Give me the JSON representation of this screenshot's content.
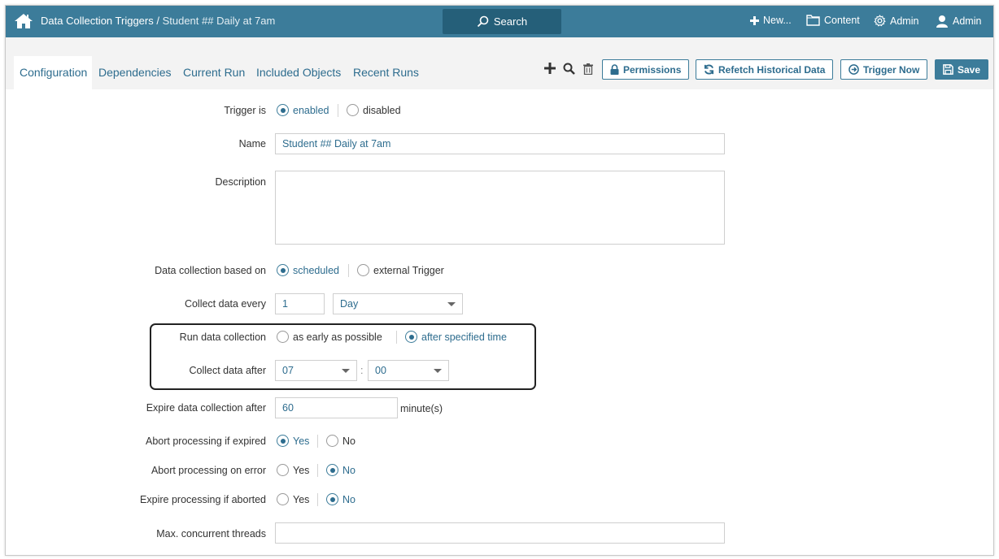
{
  "header": {
    "breadcrumb_root": "Data Collection Triggers",
    "breadcrumb_sep": " / ",
    "breadcrumb_current": "Student ## Daily at 7am",
    "search_label": "Search",
    "new_label": "New...",
    "content_label": "Content",
    "admin_settings_label": "Admin",
    "user_label": "Admin"
  },
  "tabs": {
    "configuration": "Configuration",
    "dependencies": "Dependencies",
    "current_run": "Current Run",
    "included_objects": "Included Objects",
    "recent_runs": "Recent Runs"
  },
  "toolbar": {
    "permissions_label": "Permissions",
    "refetch_label": "Refetch Historical Data",
    "trigger_now_label": "Trigger Now",
    "save_label": "Save"
  },
  "form": {
    "trigger_is": {
      "label": "Trigger is",
      "enabled": "enabled",
      "disabled": "disabled",
      "selected": "enabled"
    },
    "name": {
      "label": "Name",
      "value": "Student ## Daily at 7am"
    },
    "description": {
      "label": "Description",
      "value": ""
    },
    "based_on": {
      "label": "Data collection based on",
      "scheduled": "scheduled",
      "external": "external Trigger",
      "selected": "scheduled"
    },
    "collect_every": {
      "label": "Collect data every",
      "value": "1",
      "unit": "Day"
    },
    "run_collection": {
      "label": "Run data collection",
      "early": "as early as possible",
      "after_time": "after specified time",
      "selected": "after specified time"
    },
    "collect_after": {
      "label": "Collect data after",
      "hour": "07",
      "colon": ":",
      "minute": "00"
    },
    "expire_after": {
      "label": "Expire data collection after",
      "value": "60",
      "unit": "minute(s)"
    },
    "abort_expired": {
      "label": "Abort processing if expired",
      "yes": "Yes",
      "no": "No",
      "selected": "Yes"
    },
    "abort_error": {
      "label": "Abort processing on error",
      "yes": "Yes",
      "no": "No",
      "selected": "No"
    },
    "expire_aborted": {
      "label": "Expire processing if aborted",
      "yes": "Yes",
      "no": "No",
      "selected": "No"
    },
    "max_threads": {
      "label": "Max. concurrent threads",
      "value": ""
    }
  },
  "colors": {
    "header_bg": "#3c7c9a",
    "search_bg": "#255f79",
    "accent": "#2d6c8e"
  }
}
